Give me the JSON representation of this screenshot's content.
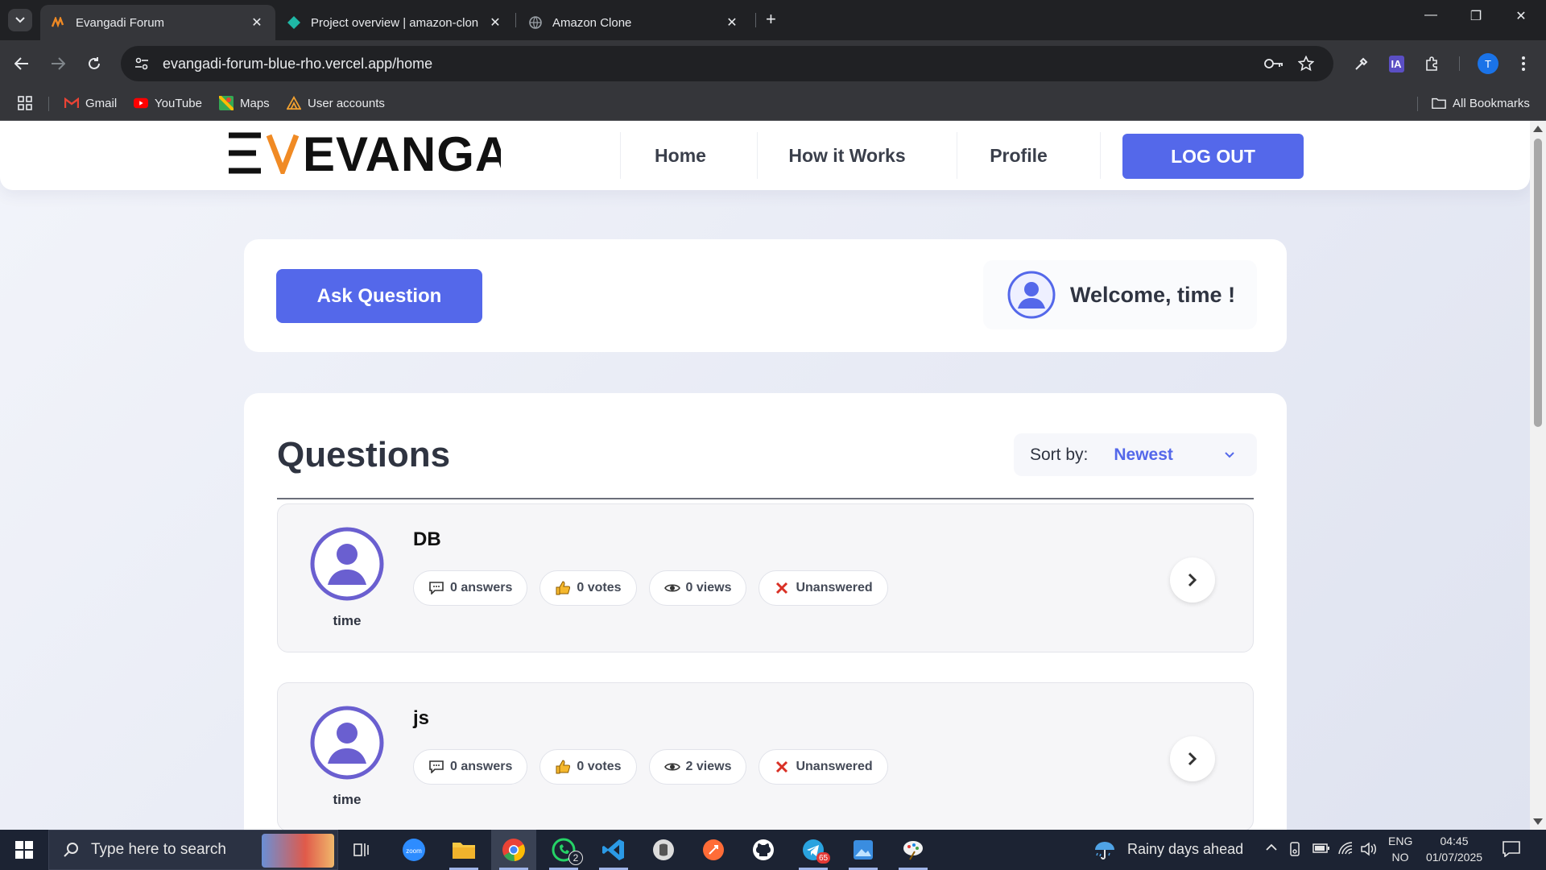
{
  "browser": {
    "tabs": [
      {
        "title": "Evangadi Forum",
        "active": true,
        "favicon": "evangadi-favicon"
      },
      {
        "title": "Project overview | amazon-clon",
        "active": false,
        "favicon": "diamond-favicon"
      },
      {
        "title": "Amazon Clone",
        "active": false,
        "favicon": "globe-favicon"
      }
    ],
    "url": "evangadi-forum-blue-rho.vercel.app/home",
    "profile_initial": "T",
    "ext_label": "IA",
    "bookmarks": [
      {
        "label": "Gmail",
        "icon": "gmail-icon"
      },
      {
        "label": "YouTube",
        "icon": "youtube-icon"
      },
      {
        "label": "Maps",
        "icon": "maps-icon"
      },
      {
        "label": "User accounts",
        "icon": "user-accounts-icon"
      }
    ],
    "all_bookmarks": "All Bookmarks"
  },
  "header": {
    "logo": "EVANGADI",
    "nav": {
      "home": "Home",
      "how": "How it Works",
      "profile": "Profile"
    },
    "logout": "LOG OUT"
  },
  "ask": {
    "button": "Ask Question",
    "welcome": "Welcome, time !"
  },
  "questions": {
    "title": "Questions",
    "sort_label": "Sort by:",
    "sort_value": "Newest",
    "items": [
      {
        "user": "time",
        "title": "DB",
        "answers": "0 answers",
        "votes": "0 votes",
        "views": "0 views",
        "status": "Unanswered"
      },
      {
        "user": "time",
        "title": "js",
        "answers": "0 answers",
        "votes": "0 votes",
        "views": "2 views",
        "status": "Unanswered"
      }
    ]
  },
  "taskbar": {
    "search_placeholder": "Type here to search",
    "whatsapp_badge": "2",
    "telegram_badge": "65",
    "weather": "Rainy days ahead",
    "lang_top": "ENG",
    "lang_bottom": "NO",
    "time": "04:45",
    "date": "01/07/2025"
  },
  "colors": {
    "accent": "#5468ea",
    "avatar_purple": "#6a5fd0",
    "status_red": "#d93025"
  }
}
